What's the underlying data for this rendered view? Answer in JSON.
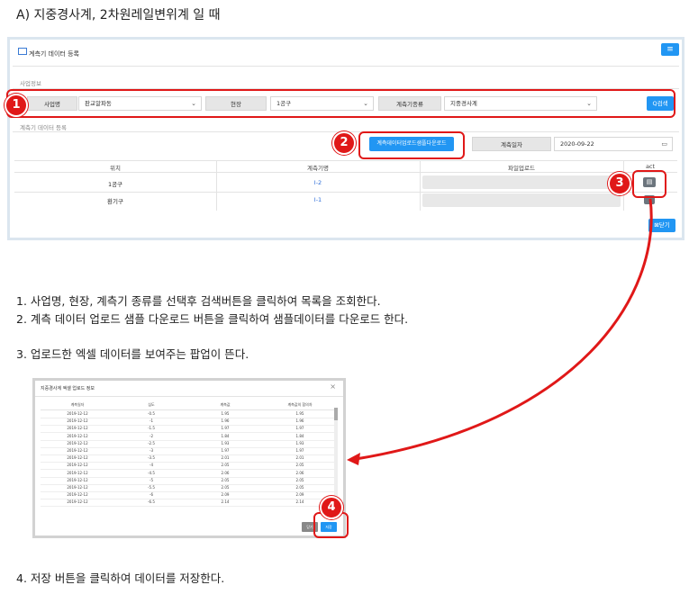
{
  "heading": "A)  지중경사계, 2차원레일변위계 일 때",
  "panel": {
    "title": "계측기 데이터 등록",
    "menu_glyph": "≡",
    "section_business": "사업정보",
    "section_upload": "계측기 데이터 등록",
    "filters": {
      "project_label": "사업명",
      "project_value": "판교알파동",
      "site_label": "현장",
      "site_value": "1공구",
      "type_label": "계측기종류",
      "type_value": "지중경사계",
      "search_button": "Q검색"
    },
    "sample_download_button": "계측데이터업로드샘플다운로드",
    "date_label": "계측일자",
    "date_value": "2020-09-22",
    "table": {
      "headers": [
        "위치",
        "계측기명",
        "파일업로드",
        "act"
      ],
      "rows": [
        {
          "location": "1공구",
          "name": "I-2"
        },
        {
          "location": "환기구",
          "name": "I-1"
        }
      ]
    },
    "close_button": "닫기"
  },
  "badges": [
    "1",
    "2",
    "3",
    "4"
  ],
  "instructions": {
    "step1": "1. 사업명, 현장, 계측기 종류를 선택후 검색버튼을 클릭하여 목록을 조회한다.",
    "step2": "2. 계측 데이터 업로드 샘플 다운로드 버튼을 클릭하여 샘플데이터를 다운로드 한다.",
    "step3": "3. 업로드한 엑셀 데이터를 보여주는 팝업이 뜬다.",
    "step4": "4. 저장 버튼을 클릭하여 데이터를 저장한다."
  },
  "popup": {
    "title": "지중경사계 엑셀 업로드 정보",
    "close_glyph": "×",
    "headers": [
      "계측일자",
      "심도",
      "계측값",
      "계측값의 합의차"
    ],
    "rows": [
      [
        "2019-12-12",
        "-0.5",
        "1.95",
        "1.95"
      ],
      [
        "2019-12-12",
        "-1",
        "1.96",
        "1.96"
      ],
      [
        "2019-12-12",
        "-1.5",
        "1.97",
        "1.97"
      ],
      [
        "2019-12-12",
        "-2",
        "1.84",
        "1.84"
      ],
      [
        "2019-12-12",
        "-2.5",
        "1.93",
        "1.93"
      ],
      [
        "2019-12-12",
        "-3",
        "1.97",
        "1.97"
      ],
      [
        "2019-12-12",
        "-3.5",
        "2.01",
        "2.01"
      ],
      [
        "2019-12-12",
        "-4",
        "2.05",
        "2.05"
      ],
      [
        "2019-12-12",
        "-4.5",
        "2.06",
        "2.06"
      ],
      [
        "2019-12-12",
        "-5",
        "2.05",
        "2.05"
      ],
      [
        "2019-12-12",
        "-5.5",
        "2.05",
        "2.05"
      ],
      [
        "2019-12-12",
        "-6",
        "2.09",
        "2.09"
      ],
      [
        "2019-12-12",
        "-6.5",
        "2.14",
        "2.14"
      ]
    ],
    "cancel_button": "닫기",
    "save_button": "저장"
  },
  "colors": {
    "accent": "#2196f3",
    "annotation": "#e01818"
  }
}
